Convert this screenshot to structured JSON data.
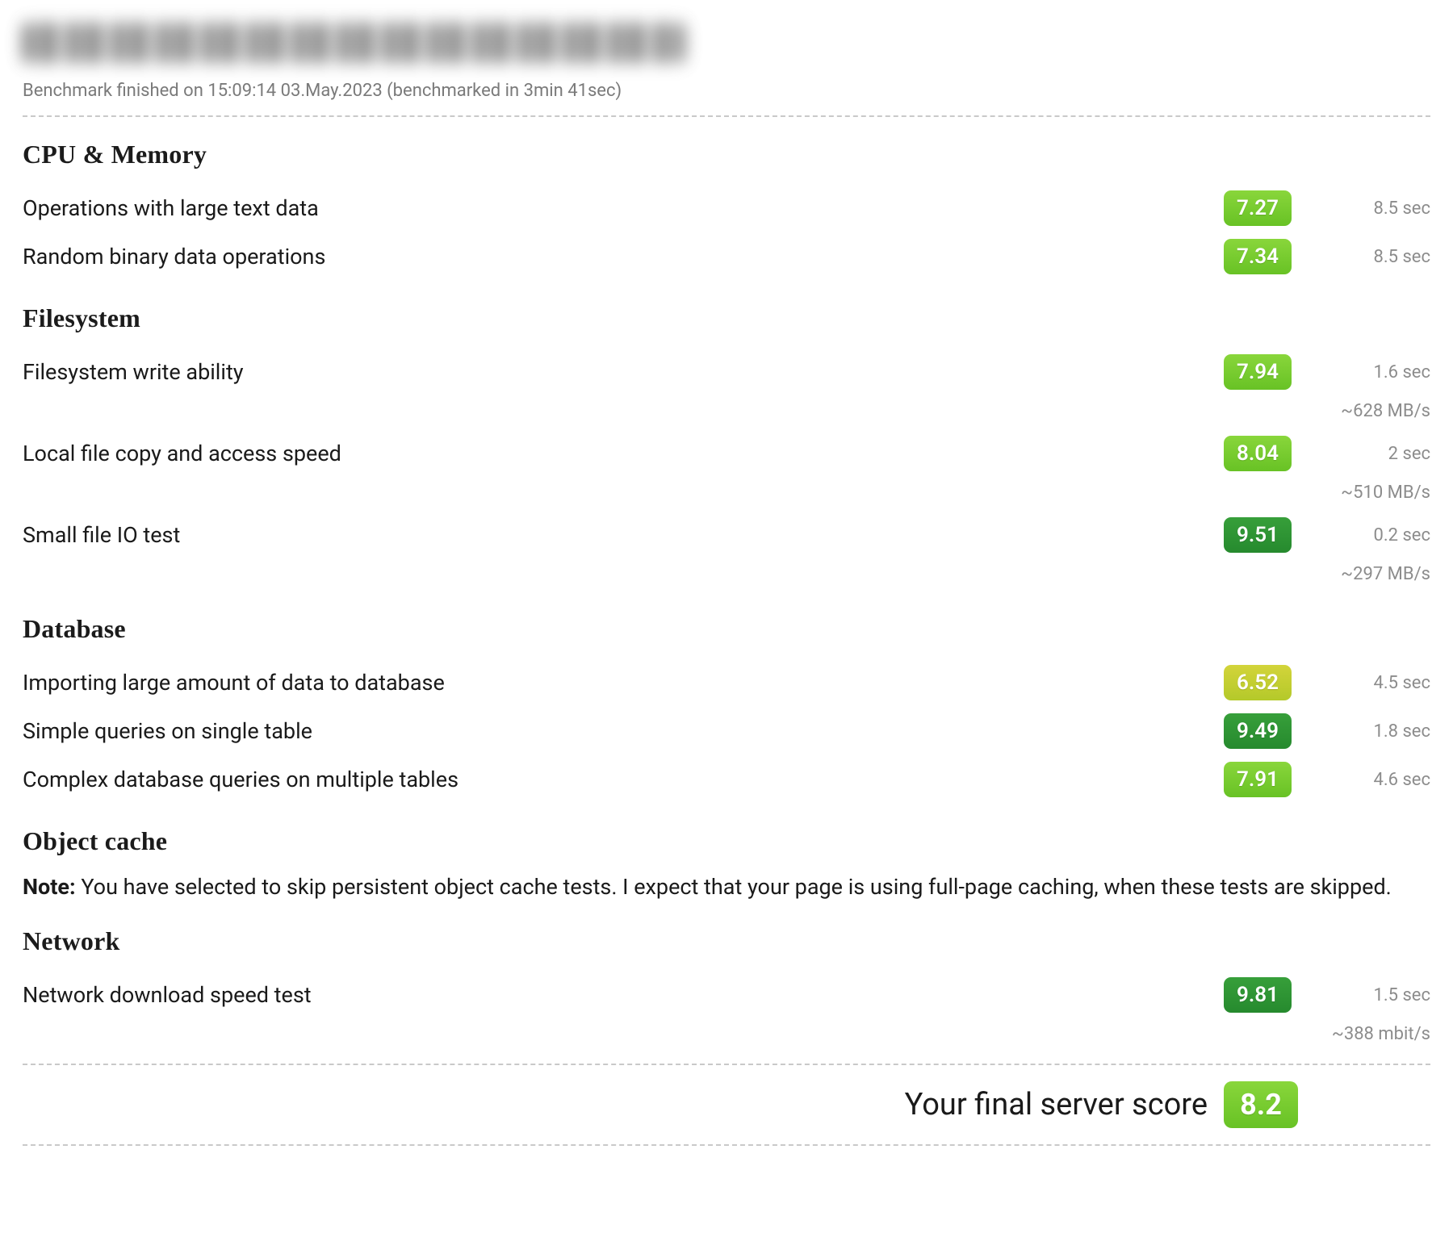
{
  "meta_line": "Benchmark finished on 15:09:14 03.May.2023 (benchmarked in 3min 41sec)",
  "sections": {
    "cpu": {
      "title": "CPU & Memory",
      "rows": [
        {
          "label": "Operations with large text data",
          "score": "7.27",
          "tier": "lime",
          "t1": "8.5 sec"
        },
        {
          "label": "Random binary data operations",
          "score": "7.34",
          "tier": "lime",
          "t1": "8.5 sec"
        }
      ]
    },
    "fs": {
      "title": "Filesystem",
      "rows": [
        {
          "label": "Filesystem write ability",
          "score": "7.94",
          "tier": "lime",
          "t1": "1.6 sec",
          "t2": "~628 MB/s"
        },
        {
          "label": "Local file copy and access speed",
          "score": "8.04",
          "tier": "lime",
          "t1": "2 sec",
          "t2": "~510 MB/s"
        },
        {
          "label": "Small file IO test",
          "score": "9.51",
          "tier": "green",
          "t1": "0.2 sec",
          "t2": "~297 MB/s"
        }
      ]
    },
    "db": {
      "title": "Database",
      "rows": [
        {
          "label": "Importing large amount of data to database",
          "score": "6.52",
          "tier": "yellow",
          "t1": "4.5 sec"
        },
        {
          "label": "Simple queries on single table",
          "score": "9.49",
          "tier": "green",
          "t1": "1.8 sec"
        },
        {
          "label": "Complex database queries on multiple tables",
          "score": "7.91",
          "tier": "lime",
          "t1": "4.6 sec"
        }
      ]
    },
    "cache": {
      "title": "Object cache",
      "note_bold": "Note:",
      "note_text": " You have selected to skip persistent object cache tests. I expect that your page is using full-page caching, when these tests are skipped."
    },
    "net": {
      "title": "Network",
      "rows": [
        {
          "label": "Network download speed test",
          "score": "9.81",
          "tier": "green",
          "t1": "1.5 sec",
          "t2": "~388 mbit/s"
        }
      ]
    }
  },
  "final": {
    "label": "Your final server score",
    "score": "8.2"
  }
}
